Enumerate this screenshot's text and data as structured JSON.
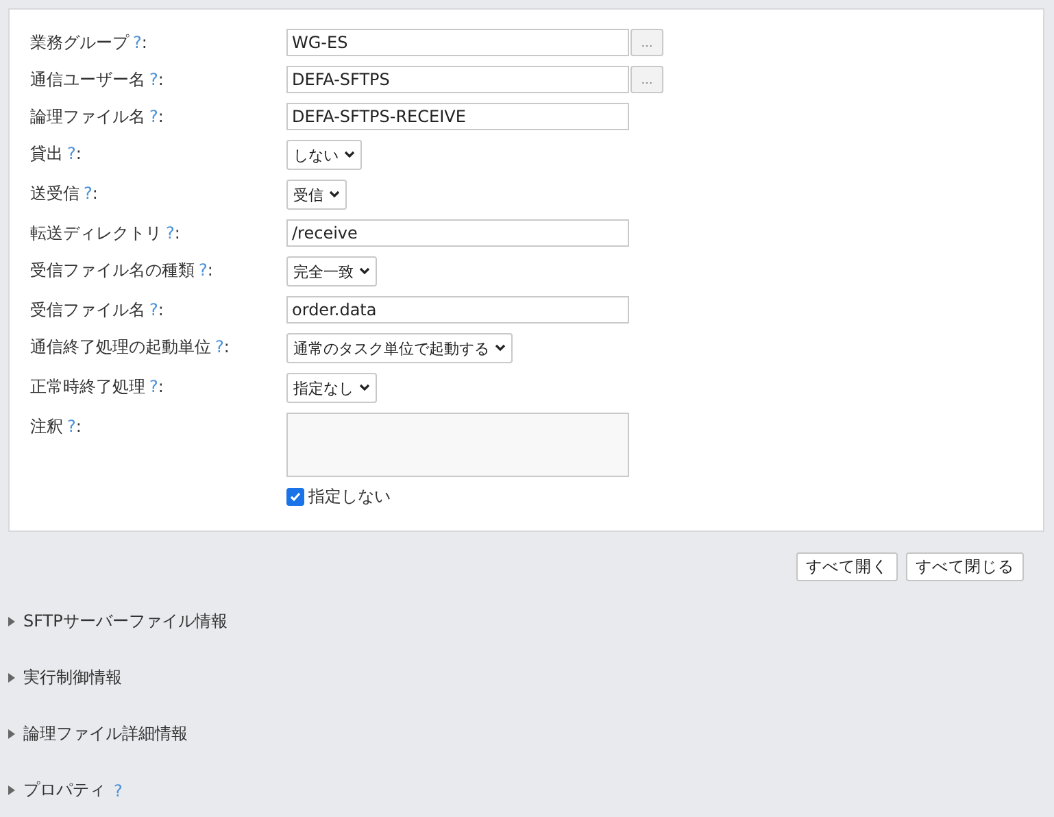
{
  "form": {
    "fields": [
      {
        "kind": "text",
        "label": "業務グループ",
        "help": "?",
        "colon": ":",
        "value": "WG-ES",
        "lookup": "…"
      },
      {
        "kind": "text",
        "label": "通信ユーザー名",
        "help": "?",
        "colon": ":",
        "value": "DEFA-SFTPS",
        "lookup": "…"
      },
      {
        "kind": "text",
        "label": "論理ファイル名",
        "help": "?",
        "colon": ":",
        "value": "DEFA-SFTPS-RECEIVE"
      },
      {
        "kind": "select",
        "label": "貸出",
        "help": "?",
        "colon": ":",
        "value": "しない"
      },
      {
        "kind": "select",
        "label": "送受信",
        "help": "?",
        "colon": ":",
        "value": "受信"
      },
      {
        "kind": "text",
        "label": "転送ディレクトリ",
        "help": "?",
        "colon": ":",
        "value": "/receive"
      },
      {
        "kind": "select",
        "label": "受信ファイル名の種類",
        "help": "?",
        "colon": ":",
        "value": "完全一致"
      },
      {
        "kind": "text",
        "label": "受信ファイル名",
        "help": "?",
        "colon": ":",
        "value": "order.data"
      },
      {
        "kind": "select",
        "label": "通信終了処理の起動単位",
        "help": "?",
        "colon": ":",
        "value": "通常のタスク単位で起動する"
      },
      {
        "kind": "select",
        "label": "正常時終了処理",
        "help": "?",
        "colon": ":",
        "value": "指定なし"
      },
      {
        "kind": "textarea",
        "label": "注釈",
        "help": "?",
        "colon": ":",
        "checkbox": {
          "label": "指定しない",
          "checked": true
        }
      }
    ]
  },
  "buttons": [
    "すべて開く",
    "すべて閉じる"
  ],
  "sections": [
    {
      "title": "SFTPサーバーファイル情報",
      "expanded": false
    },
    {
      "title": "実行制御情報",
      "expanded": false
    },
    {
      "title": "論理ファイル詳細情報",
      "expanded": false
    },
    {
      "title": "プロパティ",
      "expanded": false,
      "help": "?"
    }
  ]
}
